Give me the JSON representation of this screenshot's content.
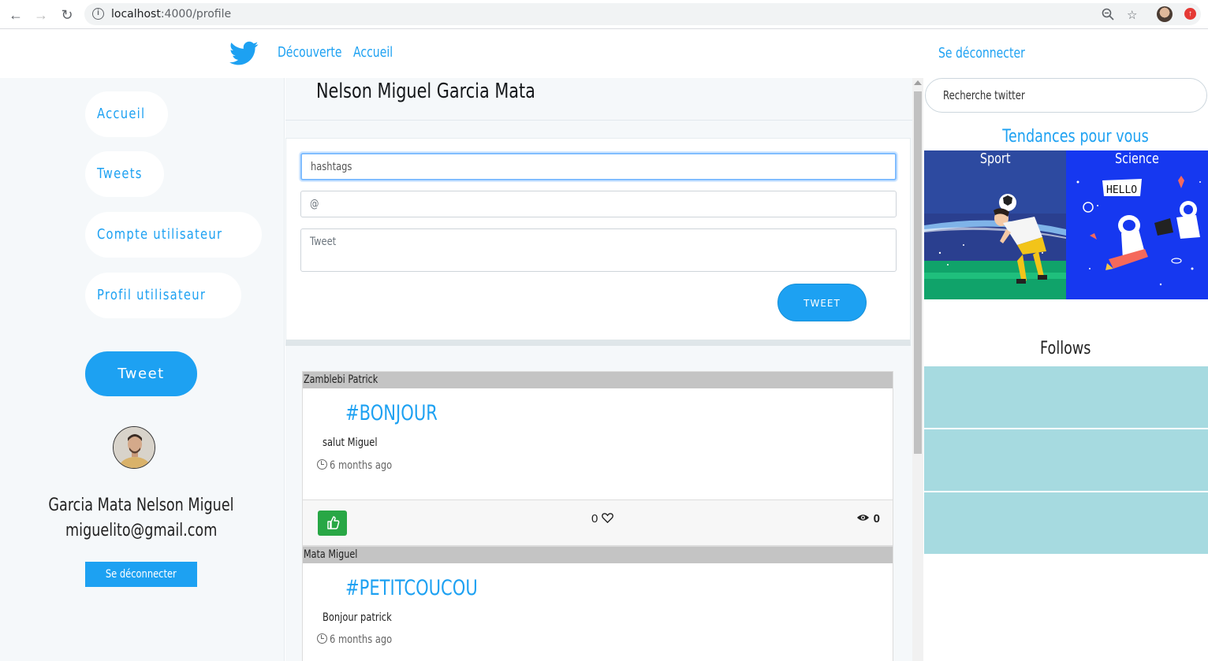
{
  "browser": {
    "url_host": "localhost",
    "url_path": ":4000/profile"
  },
  "topnav": {
    "links": [
      {
        "label": "Découverte"
      },
      {
        "label": "Accueil"
      }
    ],
    "logout_label": "Se déconnecter"
  },
  "sidebar": {
    "items": [
      {
        "label": "Accueil"
      },
      {
        "label": "Tweets"
      },
      {
        "label": "Compte utilisateur"
      },
      {
        "label": "Profil utilisateur"
      }
    ],
    "tweet_button": "Tweet",
    "user_name": "Garcia Mata Nelson Miguel",
    "user_email": "miguelito@gmail.com",
    "logout_label": "Se déconnecter"
  },
  "profile": {
    "title": "Nelson Miguel Garcia Mata"
  },
  "compose": {
    "hashtags_placeholder": "hashtags",
    "mention_placeholder": "@",
    "tweet_placeholder": "Tweet",
    "submit_label": "TWEET"
  },
  "posts": [
    {
      "author": "Zamblebi Patrick",
      "hashtag": "#BONJOUR",
      "text": "salut Miguel",
      "time": "6 months ago",
      "likes": "0",
      "views": "0"
    },
    {
      "author": "Mata Miguel",
      "hashtag": "#PETITCOUCOU",
      "text": "Bonjour patrick",
      "time": "6 months ago"
    }
  ],
  "right": {
    "search_placeholder": "Recherche twitter",
    "trends_title": "Tendances pour vous",
    "trends": [
      {
        "label": "Sport"
      },
      {
        "label": "Science"
      }
    ],
    "follows_title": "Follows"
  },
  "colors": {
    "accent": "#1da1f2",
    "like_green": "#28a745",
    "follow_row": "#a6dae0"
  }
}
